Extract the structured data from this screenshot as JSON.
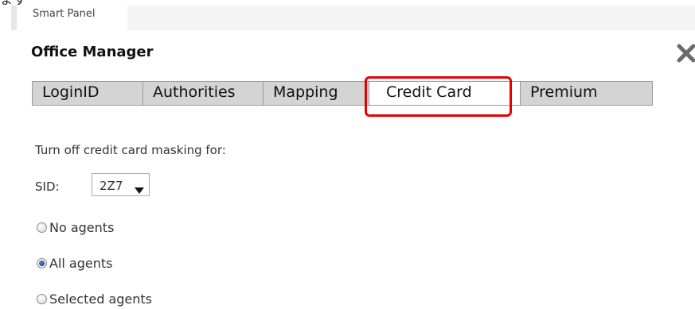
{
  "clipped_top_text": "ます",
  "panel_tab": {
    "label": "Smart Panel"
  },
  "dialog": {
    "title": "Office Manager"
  },
  "tabs": [
    {
      "label": "LoginID",
      "active": false
    },
    {
      "label": "Authorities",
      "active": false
    },
    {
      "label": "Mapping",
      "active": false
    },
    {
      "label": "Credit Card",
      "active": true
    },
    {
      "label": "Premium",
      "active": false
    }
  ],
  "masking": {
    "label": "Turn off credit card masking for:"
  },
  "sid": {
    "label": "SID:",
    "value": "2Z7"
  },
  "radios": [
    {
      "label": "No agents",
      "checked": false
    },
    {
      "label": "All agents",
      "checked": true
    },
    {
      "label": "Selected agents",
      "checked": false
    }
  ],
  "colors": {
    "highlight": "#e60000",
    "tab_background": "#d4d4d4",
    "active_tab_background": "#ffffff"
  },
  "icons": {
    "close": "close-icon",
    "dropdown": "chevron-down-icon"
  }
}
